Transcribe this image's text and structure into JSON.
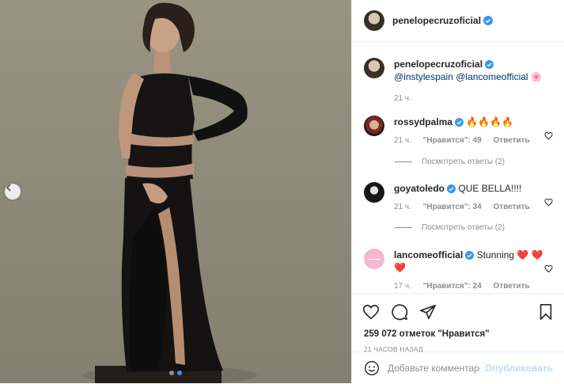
{
  "post": {
    "username": "penelopecruzoficial",
    "caption_mentions": [
      "@instylespain",
      "@lancomeofficial"
    ],
    "caption_time": "21 ч.",
    "caption_emoji": "🌸"
  },
  "comments": [
    {
      "username": "rossydpalma",
      "text": "🔥🔥🔥🔥",
      "time": "21 ч.",
      "likes": "\"Нравится\": 49",
      "reply": "Ответить",
      "view_replies": "Посмотреть ответы (2)"
    },
    {
      "username": "goyatoledo",
      "text": "QUE BELLA!!!!",
      "time": "21 ч.",
      "likes": "\"Нравится\": 34",
      "reply": "Ответить",
      "view_replies": "Посмотреть ответы (2)"
    },
    {
      "username": "lancomeofficial",
      "text": "Stunning ❤️ ❤️❤️",
      "time": "17 ч.",
      "likes": "\"Нравится\": 24",
      "reply": "Ответить"
    }
  ],
  "actions": {
    "likes_count": "259 072 отметок \"Нравится\"",
    "posted_time": "21 часов назад"
  },
  "add_comment": {
    "placeholder": "Добавьте комментарий...",
    "publish": "Опубликовать"
  },
  "colors": {
    "verified": "#3897f0",
    "link": "#00376b",
    "muted": "#8e8e8e"
  },
  "icons": [
    "chevron-left-icon",
    "heart-icon",
    "comment-icon",
    "share-icon",
    "bookmark-icon",
    "smiley-icon",
    "verified-badge-icon"
  ]
}
